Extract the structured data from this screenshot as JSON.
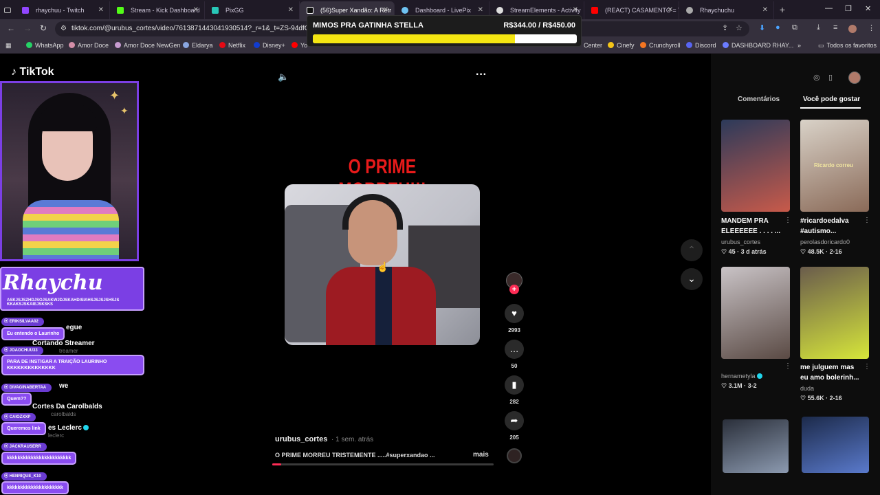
{
  "browser": {
    "tabs": [
      {
        "label": "rhaychuu - Twitch",
        "color": "#9146ff"
      },
      {
        "label": "Stream - Kick Dashboard",
        "color": "#53fc18"
      },
      {
        "label": "PixGG",
        "color": "#28c7b7"
      },
      {
        "label": "(56)Super Xandão: A Retr",
        "color": "#111111",
        "active": true
      },
      {
        "label": "Dashboard - LivePix",
        "color": "#6ec2f0"
      },
      {
        "label": "StreamElements - Activity",
        "color": "#dddddd"
      },
      {
        "label": "(REACT) CASAMENTO = T",
        "color": "#ff0000"
      },
      {
        "label": "Rhaychuchu",
        "color": "#aaaaaa"
      }
    ],
    "new_tab": "+",
    "url": "tiktok.com/@urubus_cortes/video/7613871443041930514?_r=1&_t=ZS-94dfGWW",
    "bookmarks": [
      {
        "label": "WhatsApp",
        "color": "#25d366"
      },
      {
        "label": "Amor Doce",
        "color": "#d48ea8"
      },
      {
        "label": "Amor Doce NewGen",
        "color": "#c79bd0"
      },
      {
        "label": "Eldarya",
        "color": "#8aa6e0"
      },
      {
        "label": "Netflix",
        "color": "#e50914"
      },
      {
        "label": "Disney+",
        "color": "#113ccf"
      },
      {
        "label": "Yo",
        "color": "#ff0000"
      }
    ],
    "bookmarks_right": [
      {
        "label": "Center",
        "color": ""
      },
      {
        "label": "Cinefy",
        "color": "#f5c518"
      },
      {
        "label": "Crunchyroll",
        "color": "#f47521"
      },
      {
        "label": "Discord",
        "color": "#5865f2"
      },
      {
        "label": "DASHBOARD RHAY...",
        "color": "#6b7cff"
      }
    ],
    "all_favorites": "Todos os favoritos",
    "overflow": "»"
  },
  "donation_goal": {
    "title": "MIMOS PRA GATINHA STELLA",
    "amount": "R$344.00 / R$450.00",
    "current": 344,
    "target": 450
  },
  "tiktok": {
    "logo": "TikTok"
  },
  "stream_overlay": {
    "banner_name": "Rhaychu",
    "banner_message": "ASKJSJSZHDJSOJSAKWJDJSKAHDISIAHSJSJSJSHSJS KKAKSJSKAIEJSKSKS",
    "under_items": [
      {
        "name": "Cortando Streamer",
        "sub": "treamer"
      },
      {
        "name": "Cortes Da Carolbalds",
        "sub": "carolbalds"
      },
      {
        "name": "es Leclerc",
        "sub": "leclerc"
      }
    ],
    "under_legue": "egue",
    "under_we": "we",
    "chat": [
      {
        "user": "ERIKSILVAA02",
        "message": "Eu entendo o Laurinho"
      },
      {
        "user": "JOAOCHUU33",
        "message": "PARA DE INSTIGAR A TRAIÇÃO LAURINHO KKKKKKKKKKKKKK"
      },
      {
        "user": "DIVAGINABERTAA",
        "message": "Quem??"
      },
      {
        "user": "CAIOZXXP",
        "message": "Queremos link"
      },
      {
        "user": "JACKRAUSERR",
        "message": "kkkkkkkkkkkkkkkkkkkkkkkk"
      },
      {
        "user": "HENRIQUE_K10",
        "message": "kkkkkkkkkkkkkkkkkkkkk"
      }
    ]
  },
  "video": {
    "title": "O PRIME MORREU!!!",
    "author": "urubus_cortes",
    "time": "· 1 sem. atrás",
    "caption": "O PRIME MORREU TRISTEMENTE .....#superxandao ...",
    "more": "mais",
    "progress": 0.04,
    "likes": "2993",
    "comments": "50",
    "saves": "282",
    "shares": "205",
    "follow": "+"
  },
  "right_panel": {
    "tab_comments": "Comentários",
    "tab_suggestions": "Você pode gostar",
    "items": [
      {
        "caption1": "MANDEM PRA",
        "caption2": "ELEEEEEE . . . . ...",
        "author": "urubus_cortes",
        "stats": "♡ 45 · 3 d atrás",
        "colors": [
          "#2c3a5a",
          "#c85a4a"
        ]
      },
      {
        "caption1": "#ricardoedalva",
        "caption2": "#autismo...",
        "author": "perolasdoricardo0",
        "stats": "♡ 48.5K · 2-16",
        "colors": [
          "#d9d2c8",
          "#8a6a58"
        ],
        "overlay": "Ricardo correu"
      },
      {
        "caption1": "",
        "caption2": "",
        "author": "hernametyla",
        "stats": "♡ 3.1M · 3-2",
        "colors": [
          "#c9c3c6",
          "#5a4a44"
        ],
        "verified": true
      },
      {
        "caption1": "me julguem mas",
        "caption2": "eu amo bolerinh...",
        "author": "duda",
        "stats": "♡ 55.6K · 2-16",
        "colors": [
          "#6a5c4c",
          "#d6e63a"
        ]
      },
      {
        "caption1": "",
        "caption2": "",
        "author": "",
        "stats": "",
        "colors": [
          "#2a2f3a",
          "#8c9ab0"
        ]
      },
      {
        "caption1": "",
        "caption2": "",
        "author": "",
        "stats": "",
        "colors": [
          "#1c2a4a",
          "#5a7acc"
        ]
      }
    ]
  }
}
